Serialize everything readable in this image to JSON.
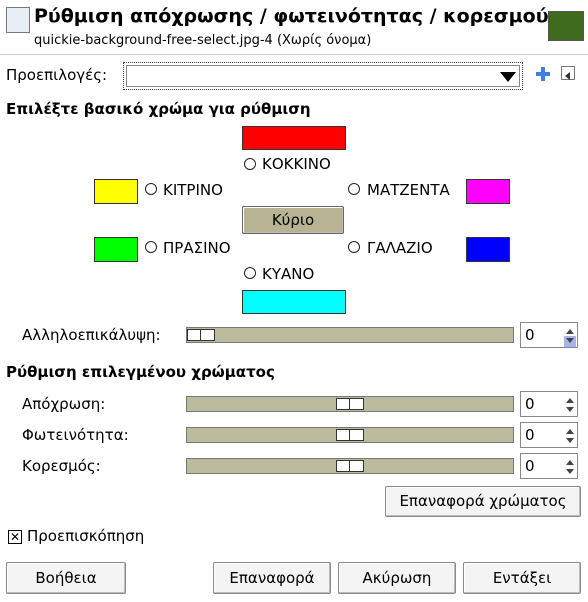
{
  "window": {
    "title": "Ρύθμιση απόχρωσης / φωτεινότητας / κορεσμού",
    "subtitle": "quickie-background-free-select.jpg-4 (Χωρίς όνομα)"
  },
  "presets": {
    "label": "Προεπιλογές:",
    "value": "",
    "add_icon": "plus-icon",
    "menu_icon": "triangle-left-icon"
  },
  "primary": {
    "heading": "Επιλέξτε βασικό χρώμα για ρύθμιση",
    "red": "ΚΟΚΚΙΝΟ",
    "yellow": "ΚΙΤΡΙΝΟ",
    "magenta": "ΜΑΤΖΕΝΤΑ",
    "master": "Κύριο",
    "green": "ΠΡΑΣΙΝΟ",
    "cyan": "ΓΑΛΑΖΙΟ",
    "blue": "ΚΥΑΝΟ",
    "colors": {
      "red": "#ff0000",
      "yellow": "#ffff00",
      "magenta": "#ff00ff",
      "green": "#00ff00",
      "cyan": "#0000ff",
      "blue": "#00ffff",
      "master": "#b7b493"
    }
  },
  "overlap": {
    "label": "Αλληλοεπικάλυψη:",
    "value": "0",
    "level_fraction": 0
  },
  "adjust": {
    "heading": "Ρύθμιση επιλεγμένου χρώματος",
    "hue_label": "Απόχρωση:",
    "hue_value": "0",
    "lightness_label": "Φωτεινότητα:",
    "lightness_value": "0",
    "saturation_label": "Κορεσμός:",
    "saturation_value": "0",
    "reset_color": "Επαναφορά χρώματος"
  },
  "preview": {
    "label": "Προεπισκόπηση",
    "checked": true,
    "mark": "✕"
  },
  "buttons": {
    "help": "Βοήθεια",
    "reset": "Επαναφορά",
    "cancel": "Ακύρωση",
    "ok": "Εντάξει"
  }
}
